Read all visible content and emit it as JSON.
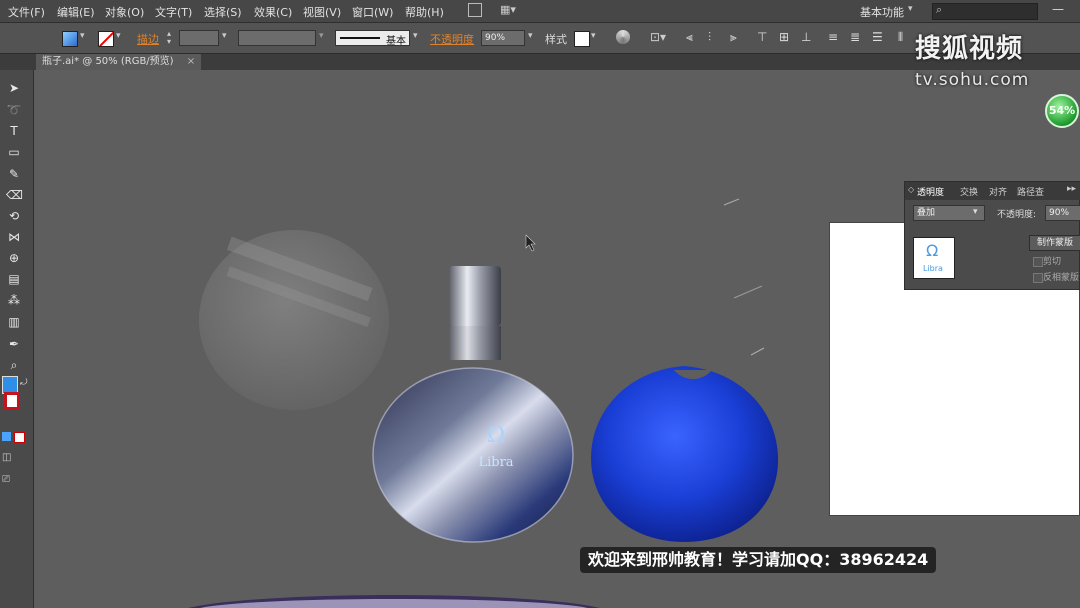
{
  "menubar": {
    "items": [
      "文件(F)",
      "编辑(E)",
      "对象(O)",
      "文字(T)",
      "选择(S)",
      "效果(C)",
      "视图(V)",
      "窗口(W)",
      "帮助(H)"
    ],
    "workspace": "基本功能"
  },
  "options_bar": {
    "stroke_label": "描边",
    "stroke_style": "基本",
    "opacity_label": "不透明度",
    "opacity_value": "90%",
    "style_label": "样式"
  },
  "document_tab": {
    "title": "瓶子.ai* @ 50% (RGB/预览)",
    "close": "×"
  },
  "transparency_panel": {
    "tabs": [
      "透明度",
      "交换",
      "对齐",
      "路径查"
    ],
    "blend_mode": "叠加",
    "opacity_label": "不透明度:",
    "opacity_value": "90%",
    "make_mask_button": "制作蒙版",
    "clip_label": "剪切",
    "invert_mask_label": "反相蒙版",
    "thumbnail_text": "Libra"
  },
  "artwork": {
    "label_text": "Libra"
  },
  "watermark": {
    "brand": "搜狐视频",
    "url": "tv.sohu.com"
  },
  "progress_badge": "54%",
  "subtitle": "欢迎来到邢帅教育！学习请加QQ：38962424",
  "colors": {
    "canvas": "#5f5f5f",
    "panel": "#4b4b4b",
    "accent_orange": "#e0822a",
    "bottle_blue": "#1a3fd6"
  }
}
